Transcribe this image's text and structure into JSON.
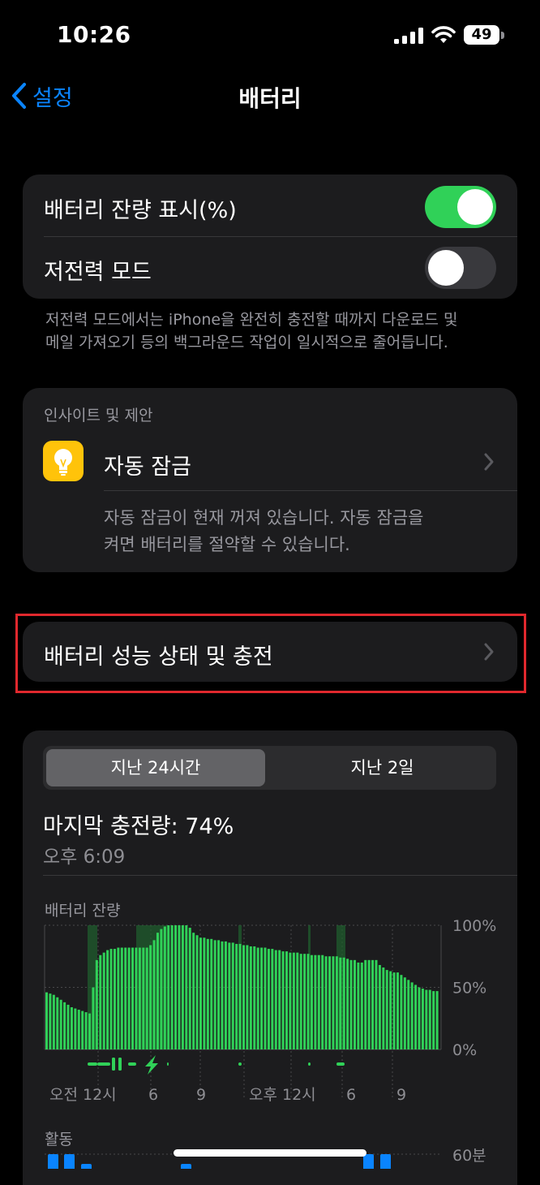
{
  "status_bar": {
    "time": "10:26",
    "battery_level": "49"
  },
  "nav": {
    "back_label": "설정",
    "title": "배터리"
  },
  "toggles": {
    "battery_percentage_label": "배터리 잔량 표시(%)",
    "battery_percentage_on": true,
    "low_power_label": "저전력 모드",
    "low_power_on": false,
    "low_power_footnote_line1": "저전력 모드에서는 iPhone을 완전히 충전할 때까지 다운로드 및",
    "low_power_footnote_line2": "메일 가져오기 등의 백그라운드 작업이 일시적으로 줄어듭니다."
  },
  "insights": {
    "header": "인사이트 및 제안",
    "item_label": "자동 잠금",
    "desc_line1": "자동 잠금이 현재 꺼져 있습니다. 자동 잠금을",
    "desc_line2": "켜면 배터리를 절약할 수 있습니다."
  },
  "health": {
    "label": "배터리 성능 상태 및 충전"
  },
  "usage": {
    "segments": [
      "지난 24시간",
      "지난 2일"
    ],
    "selected_segment": 0,
    "last_charge": "마지막 충전량: 74%",
    "last_charge_time": "오후 6:09",
    "battery_level_title": "배터리 잔량",
    "activity_title": "활동"
  },
  "chart_data": [
    {
      "type": "bar",
      "title": "배터리 잔량",
      "y_tick_labels": [
        "100%",
        "50%",
        "0%"
      ],
      "ylim": [
        0,
        100
      ],
      "x_tick_labels": [
        "오전 12시",
        "6",
        "9",
        "오후 12시",
        "6",
        "9"
      ],
      "bar_color": "#30d158",
      "charging_highlight_color": "#1f5c2e",
      "values": [
        46,
        45,
        44,
        42,
        40,
        38,
        36,
        34,
        33,
        32,
        31,
        30,
        29,
        50,
        72,
        76,
        78,
        80,
        81,
        81,
        82,
        82,
        82,
        82,
        82,
        82,
        82,
        82,
        82,
        84,
        88,
        94,
        97,
        99,
        100,
        100,
        100,
        100,
        100,
        100,
        98,
        94,
        92,
        90,
        90,
        89,
        89,
        88,
        88,
        87,
        87,
        86,
        86,
        85,
        85,
        84,
        84,
        83,
        83,
        82,
        82,
        82,
        81,
        81,
        80,
        80,
        79,
        79,
        78,
        78,
        78,
        77,
        77,
        77,
        76,
        76,
        76,
        76,
        75,
        75,
        75,
        75,
        74,
        74,
        73,
        72,
        72,
        70,
        70,
        72,
        72,
        72,
        72,
        68,
        66,
        64,
        63,
        62,
        62,
        60,
        58,
        56,
        54,
        52,
        50,
        49,
        48,
        48,
        47,
        47
      ]
    },
    {
      "type": "bar",
      "title": "활동",
      "y_tick_labels": [
        "60분"
      ],
      "bar_color": "#0a84ff"
    }
  ]
}
